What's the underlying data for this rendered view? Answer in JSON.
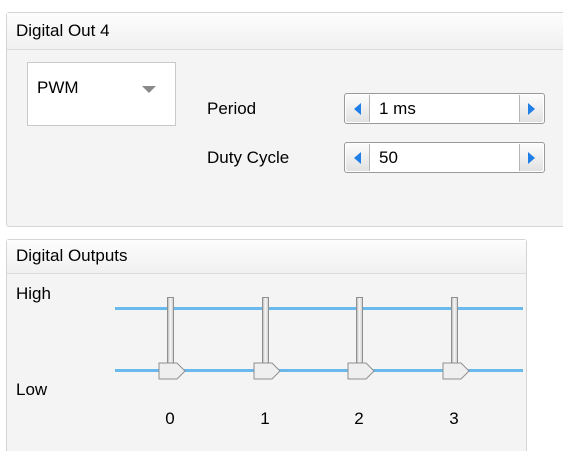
{
  "digital_out_panel": {
    "title": "Digital Out 4",
    "mode_select": {
      "value": "PWM"
    },
    "period": {
      "label": "Period",
      "value": "1 ms"
    },
    "duty_cycle": {
      "label": "Duty Cycle",
      "value": "50"
    }
  },
  "digital_outputs_panel": {
    "title": "Digital Outputs",
    "high_label": "High",
    "low_label": "Low",
    "channels": [
      {
        "label": "0",
        "state": "Low"
      },
      {
        "label": "1",
        "state": "Low"
      },
      {
        "label": "2",
        "state": "Low"
      },
      {
        "label": "3",
        "state": "Low"
      }
    ]
  },
  "colors": {
    "accent_arrow": "#1f7fe6",
    "track_line": "#6ab9ec"
  }
}
